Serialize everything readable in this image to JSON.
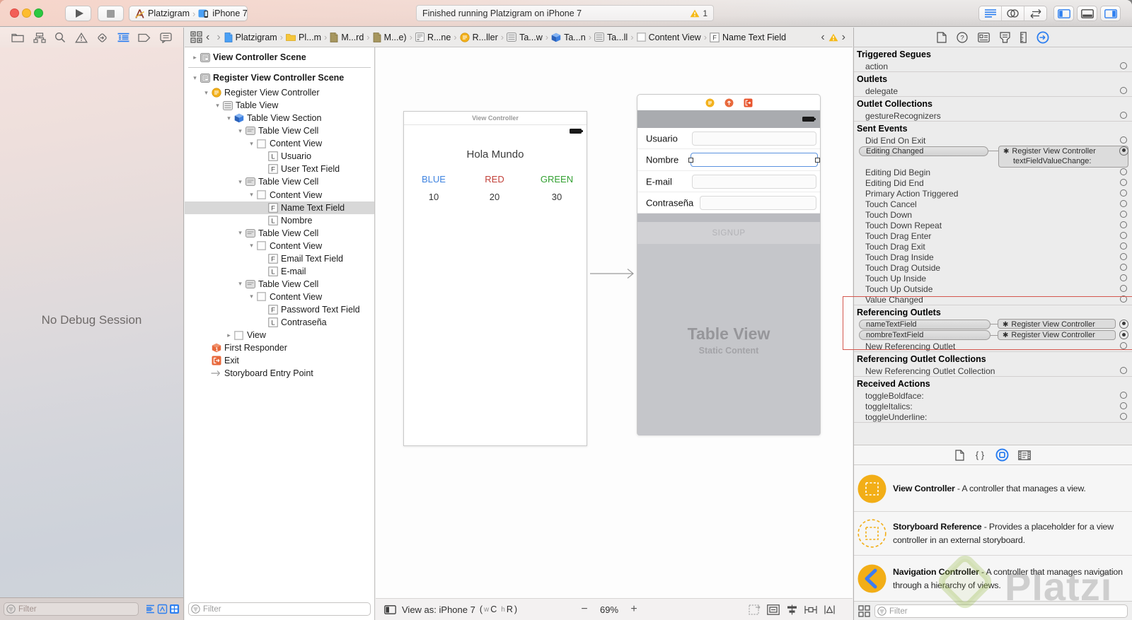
{
  "toolbar": {
    "scheme_project": "Platzigram",
    "scheme_separator": "›",
    "scheme_device": "iPhone 7",
    "status_message": "Finished running Platzigram on iPhone 7",
    "status_warning_count": "1"
  },
  "jumpbar": {
    "back_chevron": "‹",
    "forward_chevron": "›",
    "crumbs": [
      {
        "label": "Platzigram",
        "icon": "doc-blue"
      },
      {
        "label": "Pl...m",
        "icon": "folder-mini"
      },
      {
        "label": "M...rd",
        "icon": "doc-dark"
      },
      {
        "label": "M...e)",
        "icon": "doc-dark"
      },
      {
        "label": "R...ne",
        "icon": "storyboard-file"
      },
      {
        "label": "R...ller",
        "icon": "vc-circle"
      },
      {
        "label": "Ta...w",
        "icon": "tableview"
      },
      {
        "label": "Ta...n",
        "icon": "cube"
      },
      {
        "label": "Ta...ll",
        "icon": "tableview"
      },
      {
        "label": "Content View",
        "icon": "view-square"
      },
      {
        "label": "Name Text Field",
        "icon": "badge-f"
      }
    ]
  },
  "navigator": {
    "empty_message": "No Debug Session",
    "filter_placeholder": "Filter"
  },
  "outline": {
    "filter_placeholder": "Filter",
    "rows": [
      {
        "label": "View Controller Scene",
        "icon": "scene",
        "level": 0,
        "disclosure": "collapsed",
        "scene": true
      },
      {
        "separator": true
      },
      {
        "label": "Register View Controller Scene",
        "icon": "scene",
        "level": 0,
        "disclosure": "expanded",
        "scene": true
      },
      {
        "label": "Register View Controller",
        "icon": "vc-circle",
        "level": 1,
        "disclosure": "expanded",
        "gap": 3
      },
      {
        "label": "Table View",
        "icon": "tableview",
        "level": 2,
        "disclosure": "expanded"
      },
      {
        "label": "Table View Section",
        "icon": "cube",
        "level": 3,
        "disclosure": "expanded"
      },
      {
        "label": "Table View Cell",
        "icon": "cell",
        "level": 4,
        "disclosure": "expanded"
      },
      {
        "label": "Content View",
        "icon": "view-square",
        "level": 5,
        "disclosure": "expanded"
      },
      {
        "label": "Usuario",
        "icon": "badge-l",
        "level": 6
      },
      {
        "label": "User Text Field",
        "icon": "badge-f",
        "level": 6
      },
      {
        "label": "Table View Cell",
        "icon": "cell",
        "level": 4,
        "disclosure": "expanded"
      },
      {
        "label": "Content View",
        "icon": "view-square",
        "level": 5,
        "disclosure": "expanded"
      },
      {
        "label": "Name Text Field",
        "icon": "badge-f",
        "level": 6,
        "selected": true
      },
      {
        "label": "Nombre",
        "icon": "badge-l",
        "level": 6
      },
      {
        "label": "Table View Cell",
        "icon": "cell",
        "level": 4,
        "disclosure": "expanded"
      },
      {
        "label": "Content View",
        "icon": "view-square",
        "level": 5,
        "disclosure": "expanded"
      },
      {
        "label": "Email Text Field",
        "icon": "badge-f",
        "level": 6
      },
      {
        "label": "E-mail",
        "icon": "badge-l",
        "level": 6
      },
      {
        "label": "Table View Cell",
        "icon": "cell",
        "level": 4,
        "disclosure": "expanded"
      },
      {
        "label": "Content View",
        "icon": "view-square",
        "level": 5,
        "disclosure": "expanded"
      },
      {
        "label": "Password Text Field",
        "icon": "badge-f",
        "level": 6
      },
      {
        "label": "Contraseña",
        "icon": "badge-l",
        "level": 6
      },
      {
        "label": "View",
        "icon": "view-square",
        "level": 3,
        "disclosure": "collapsed"
      },
      {
        "label": "First Responder",
        "icon": "first-responder",
        "level": 1
      },
      {
        "label": "Exit",
        "icon": "exit",
        "level": 1
      },
      {
        "label": "Storyboard Entry Point",
        "icon": "entry-arrow",
        "level": 1
      }
    ]
  },
  "canvas": {
    "vc1": {
      "title": "View Controller",
      "heading": "Hola Mundo",
      "columns": [
        {
          "label": "BLUE",
          "color": "#4084e0",
          "value": "10"
        },
        {
          "label": "RED",
          "color": "#c2413a",
          "value": "20"
        },
        {
          "label": "GREEN",
          "color": "#33a132",
          "value": "30"
        }
      ]
    },
    "vc2": {
      "fields": [
        {
          "label": "Usuario",
          "selected": false
        },
        {
          "label": "Nombre",
          "selected": true
        },
        {
          "label": "E-mail",
          "selected": false
        },
        {
          "label": "Contraseña",
          "selected": false
        }
      ],
      "signup_label": "SIGNUP",
      "table_title": "Table View",
      "table_subtitle": "Static Content"
    },
    "bottom_bar": {
      "view_as_label": "View as: iPhone 7",
      "paren_open": "(",
      "trait_w_key": "w",
      "trait_w_val": "C",
      "trait_h_key": "h",
      "trait_h_val": "R",
      "paren_close": ")",
      "zoom_out": "−",
      "zoom_level": "69%",
      "zoom_in": "+"
    }
  },
  "inspector": {
    "sections": [
      {
        "title": "Triggered Segues",
        "rows": [
          {
            "label": "action",
            "circle": "empty"
          }
        ]
      },
      {
        "title": "Outlets",
        "rows": [
          {
            "label": "delegate",
            "circle": "empty"
          }
        ]
      },
      {
        "title": "Outlet Collections",
        "rows": [
          {
            "label": "gestureRecognizers",
            "circle": "empty"
          }
        ]
      },
      {
        "title": "Sent Events",
        "rows": [
          {
            "label": "Did End On Exit",
            "circle": "empty"
          },
          {
            "label": "Editing Changed",
            "circle": "connected",
            "type": "event-connected",
            "target": "Register View Controller",
            "action": "textFieldValueChange:"
          },
          {
            "label": "Editing Did Begin",
            "circle": "empty"
          },
          {
            "label": "Editing Did End",
            "circle": "empty"
          },
          {
            "label": "Primary Action Triggered",
            "circle": "empty"
          },
          {
            "label": "Touch Cancel",
            "circle": "empty"
          },
          {
            "label": "Touch Down",
            "circle": "empty"
          },
          {
            "label": "Touch Down Repeat",
            "circle": "empty"
          },
          {
            "label": "Touch Drag Enter",
            "circle": "empty"
          },
          {
            "label": "Touch Drag Exit",
            "circle": "empty"
          },
          {
            "label": "Touch Drag Inside",
            "circle": "empty"
          },
          {
            "label": "Touch Drag Outside",
            "circle": "empty"
          },
          {
            "label": "Touch Up Inside",
            "circle": "empty"
          },
          {
            "label": "Touch Up Outside",
            "circle": "empty"
          },
          {
            "label": "Value Changed",
            "circle": "empty"
          }
        ]
      },
      {
        "title": "Referencing Outlets",
        "rows": [
          {
            "label": "nameTextField",
            "circle": "connected",
            "type": "outlet-connected",
            "target": "Register View Controller"
          },
          {
            "label": "nombreTextField",
            "circle": "connected",
            "type": "outlet-connected",
            "target": "Register View Controller"
          },
          {
            "label": "New Referencing Outlet",
            "circle": "empty"
          }
        ]
      },
      {
        "title": "Referencing Outlet Collections",
        "rows": [
          {
            "label": "New Referencing Outlet Collection",
            "circle": "empty"
          }
        ]
      },
      {
        "title": "Received Actions",
        "rows": [
          {
            "label": "toggleBoldface:",
            "circle": "empty"
          },
          {
            "label": "toggleItalics:",
            "circle": "empty"
          },
          {
            "label": "toggleUnderline:",
            "circle": "empty"
          }
        ]
      }
    ],
    "connection_symbol": "✱"
  },
  "library": {
    "separator": "-",
    "items": [
      {
        "title": "View Controller",
        "description": "A controller that manages a view.",
        "icon": "lib-vc"
      },
      {
        "title": "Storyboard Reference",
        "description": "Provides a placeholder for a view controller in an external storyboard.",
        "icon": "lib-sbref"
      },
      {
        "title": "Navigation Controller",
        "description": "A controller that manages navigation through a hierarchy of views.",
        "icon": "lib-nav"
      }
    ],
    "filter_placeholder": "Filter"
  },
  "watermark": {
    "text": "Platzi"
  }
}
